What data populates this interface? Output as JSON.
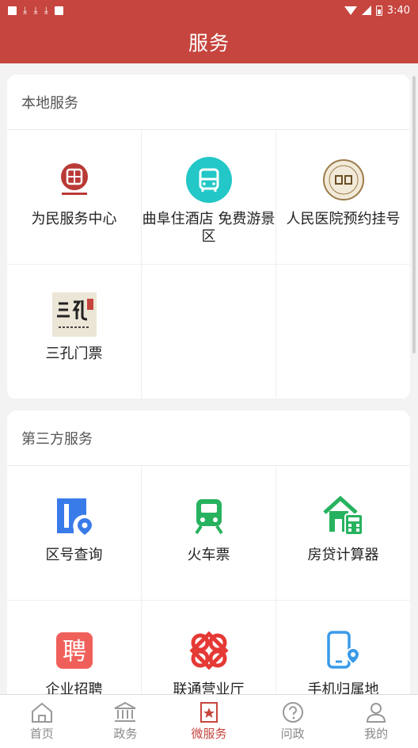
{
  "status_bar": {
    "time": "3:40",
    "icons": [
      "square-icon",
      "download-icon",
      "download-icon",
      "download-icon",
      "image-icon",
      "wifi-icon",
      "signal-icon",
      "battery-icon"
    ]
  },
  "header": {
    "title": "服务"
  },
  "local_services": {
    "title": "本地服务",
    "items": [
      {
        "label": "为民服务中心",
        "icon": "weimin-logo-icon"
      },
      {
        "label": "曲阜住酒店 免费游景区",
        "icon": "bus-icon"
      },
      {
        "label": "人民医院预约挂号",
        "icon": "hospital-logo-icon"
      },
      {
        "label": "三孔门票",
        "icon": "sankong-logo-icon"
      }
    ]
  },
  "third_party_services": {
    "title": "第三方服务",
    "items": [
      {
        "label": "区号查询",
        "icon": "area-code-icon"
      },
      {
        "label": "火车票",
        "icon": "train-icon"
      },
      {
        "label": "房贷计算器",
        "icon": "mortgage-calculator-icon"
      },
      {
        "label": "企业招聘",
        "icon": "recruit-icon"
      },
      {
        "label": "联通营业厅",
        "icon": "unicom-icon"
      },
      {
        "label": "手机归属地",
        "icon": "phone-location-icon"
      }
    ]
  },
  "tabs": [
    {
      "label": "首页",
      "icon": "home-icon"
    },
    {
      "label": "政务",
      "icon": "government-icon"
    },
    {
      "label": "微服务",
      "icon": "micro-service-icon",
      "active": true
    },
    {
      "label": "问政",
      "icon": "question-icon"
    },
    {
      "label": "我的",
      "icon": "user-icon"
    }
  ],
  "colors": {
    "brand": "#c6453e",
    "bus": "#23c7c7",
    "blue": "#3a7bea",
    "green": "#27b25f",
    "red": "#f0605a"
  }
}
